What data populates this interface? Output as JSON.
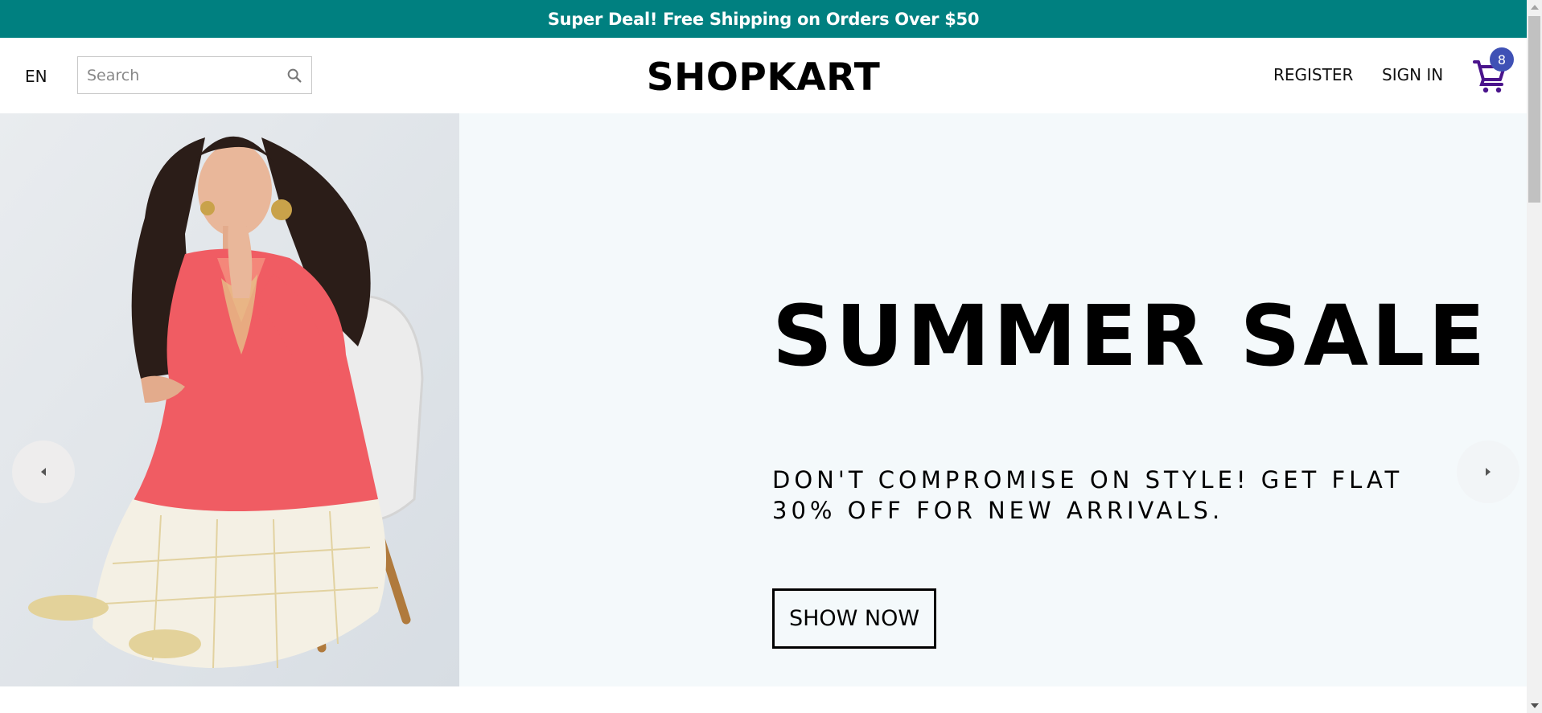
{
  "announcement": {
    "text": "Super Deal! Free Shipping on Orders Over $50"
  },
  "navbar": {
    "language": "EN",
    "search": {
      "placeholder": "Search",
      "value": "",
      "icon": "search-icon"
    },
    "logo": "SHOPKART",
    "links": {
      "register": "REGISTER",
      "sign_in": "SIGN IN"
    },
    "cart": {
      "icon": "shopping-cart-icon",
      "count": "8"
    }
  },
  "hero": {
    "image": "woman-in-coral-kurta-seated-on-chair",
    "title": "SUMMER SALE",
    "description": "DON'T COMPROMISE ON STYLE! GET FLAT 30% OFF FOR NEW ARRIVALS.",
    "button_label": "SHOW NOW",
    "prev_icon": "arrow-left-icon",
    "next_icon": "arrow-right-icon"
  },
  "colors": {
    "announcement_bg": "#008080",
    "hero_bg": "#f4f9fb",
    "cart_icon": "#4a148c",
    "badge_bg": "#3f51b5"
  }
}
